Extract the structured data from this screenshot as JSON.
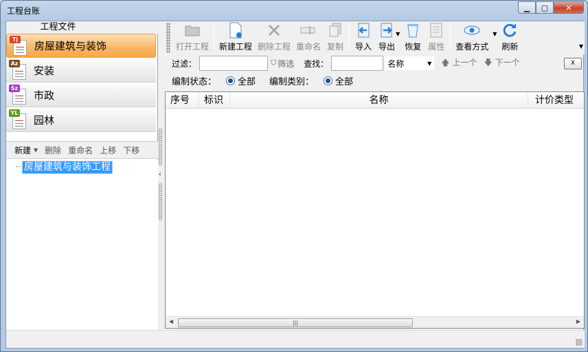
{
  "window": {
    "title": "工程台账",
    "minimize": "▁",
    "maximize": "▢",
    "close": "✕"
  },
  "left": {
    "header": "工程文件",
    "categories": [
      {
        "code": "Tj",
        "label": "房屋建筑与装饰",
        "color": "#d9432b",
        "icon": "doc-tj-icon"
      },
      {
        "code": "Az",
        "label": "安装",
        "color": "#7b4a1e",
        "icon": "doc-az-icon"
      },
      {
        "code": "Sz",
        "label": "市政",
        "color": "#a63cc4",
        "icon": "doc-sz-icon"
      },
      {
        "code": "YL",
        "label": "园林",
        "color": "#5a9e1a",
        "icon": "doc-yl-icon"
      }
    ],
    "toolbar": {
      "new": "新建",
      "new_dropdown": "▼",
      "delete": "删除",
      "rename": "重命名",
      "up": "上移",
      "down": "下移"
    },
    "tree": {
      "selected": "房屋建筑与装饰工程"
    }
  },
  "toolbar": {
    "open": "打开工程",
    "new": "新建工程",
    "delete": "删除工程",
    "rename": "重命名",
    "copy": "复制",
    "import": "导入",
    "export": "导出",
    "restore": "恢复",
    "properties": "属性",
    "view_mode": "查看方式",
    "refresh": "刷新"
  },
  "filter": {
    "filter_label": "过滤：",
    "filter_value": "",
    "filter_btn": "筛选",
    "find_label": "查找：",
    "find_value": "",
    "field_select": "名称",
    "prev": "上一个",
    "next": "下一个",
    "clear": "X"
  },
  "status_filter": {
    "state_label": "编制状态：",
    "state_value": "全部",
    "type_label": "编制类别：",
    "type_value": "全部"
  },
  "grid": {
    "columns": [
      "序号",
      "标识",
      "名称",
      "计价类型"
    ],
    "rows": []
  },
  "colors": {
    "accent": "#f8b562",
    "selection": "#3399ff",
    "blue_icon": "#2a7fd4"
  }
}
